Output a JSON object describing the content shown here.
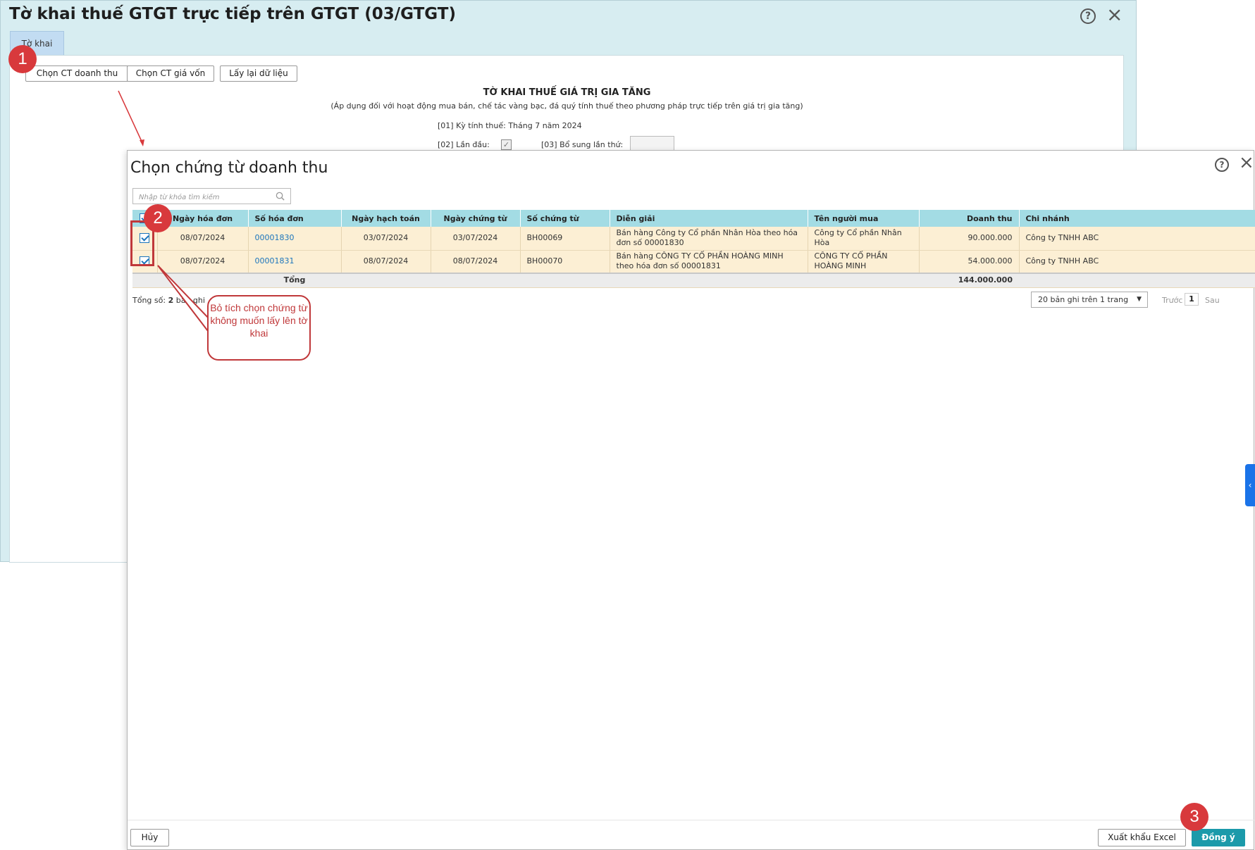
{
  "main_window": {
    "title": "Tờ khai thuế GTGT trực tiếp trên GTGT (03/GTGT)",
    "help_icon": "?",
    "close_icon": "×",
    "tab": "Tờ khai",
    "toolbar": {
      "choose_revenue": "Chọn CT doanh thu",
      "choose_cost": "Chọn CT giá vốn",
      "reload": "Lấy lại dữ liệu"
    },
    "form": {
      "heading": "TỜ KHAI THUẾ GIÁ TRỊ GIA TĂNG",
      "subheading": "(Áp dụng đối với hoạt động mua bán, chế tác vàng bạc, đá quý tính thuế theo phương pháp trực tiếp trên giá trị gia tăng)",
      "period": "[01] Kỳ tính thuế: Tháng 7 năm 2024",
      "first_time_label": "[02] Lần đầu:",
      "first_time_checked": true,
      "supplement_label": "[03] Bổ sung lần thứ:"
    }
  },
  "dialog": {
    "title": "Chọn chứng từ doanh thu",
    "help_icon": "?",
    "close_icon": "×",
    "search": {
      "placeholder": "Nhập từ khóa tìm kiếm"
    },
    "table": {
      "columns": [
        "Ngày hóa đơn",
        "Số hóa đơn",
        "Ngày hạch toán",
        "Ngày chứng từ",
        "Số chứng từ",
        "Diễn giải",
        "Tên người mua",
        "Doanh thu",
        "Chi nhánh"
      ],
      "rows": [
        {
          "checked": true,
          "invoice_date": "08/07/2024",
          "invoice_no": "00001830",
          "posting_date": "03/07/2024",
          "voucher_date": "03/07/2024",
          "voucher_no": "BH00069",
          "description": "Bán hàng Công ty Cổ phần Nhân Hòa theo hóa đơn số 00001830",
          "buyer": "Công ty Cổ phần Nhân Hòa",
          "revenue": "90.000.000",
          "branch": "Công ty TNHH ABC"
        },
        {
          "checked": true,
          "invoice_date": "08/07/2024",
          "invoice_no": "00001831",
          "posting_date": "08/07/2024",
          "voucher_date": "08/07/2024",
          "voucher_no": "BH00070",
          "description": "Bán hàng CÔNG TY CỔ PHẦN HOÀNG MINH theo hóa đơn số 00001831",
          "buyer": "CÔNG TY CỔ PHẦN HOÀNG MINH",
          "revenue": "54.000.000",
          "branch": "Công ty TNHH ABC"
        }
      ],
      "total_label": "Tổng",
      "total_revenue": "144.000.000"
    },
    "footer_info": {
      "total_prefix": "Tổng số: ",
      "total_count": "2",
      "total_suffix": " bản ghi"
    },
    "pagination": {
      "page_size": "20 bản ghi trên 1 trang",
      "prev": "Trước",
      "page": "1",
      "next": "Sau"
    },
    "side_handle_icon": "‹",
    "buttons": {
      "cancel": "Hủy",
      "export": "Xuất khẩu Excel",
      "ok": "Đồng ý"
    }
  },
  "annotations": {
    "step1": "1",
    "step2": "2",
    "step3": "3",
    "callout_text": "Bỏ tích chọn chứng từ không muốn lấy lên tờ khai",
    "accent_color": "#d8393c"
  }
}
